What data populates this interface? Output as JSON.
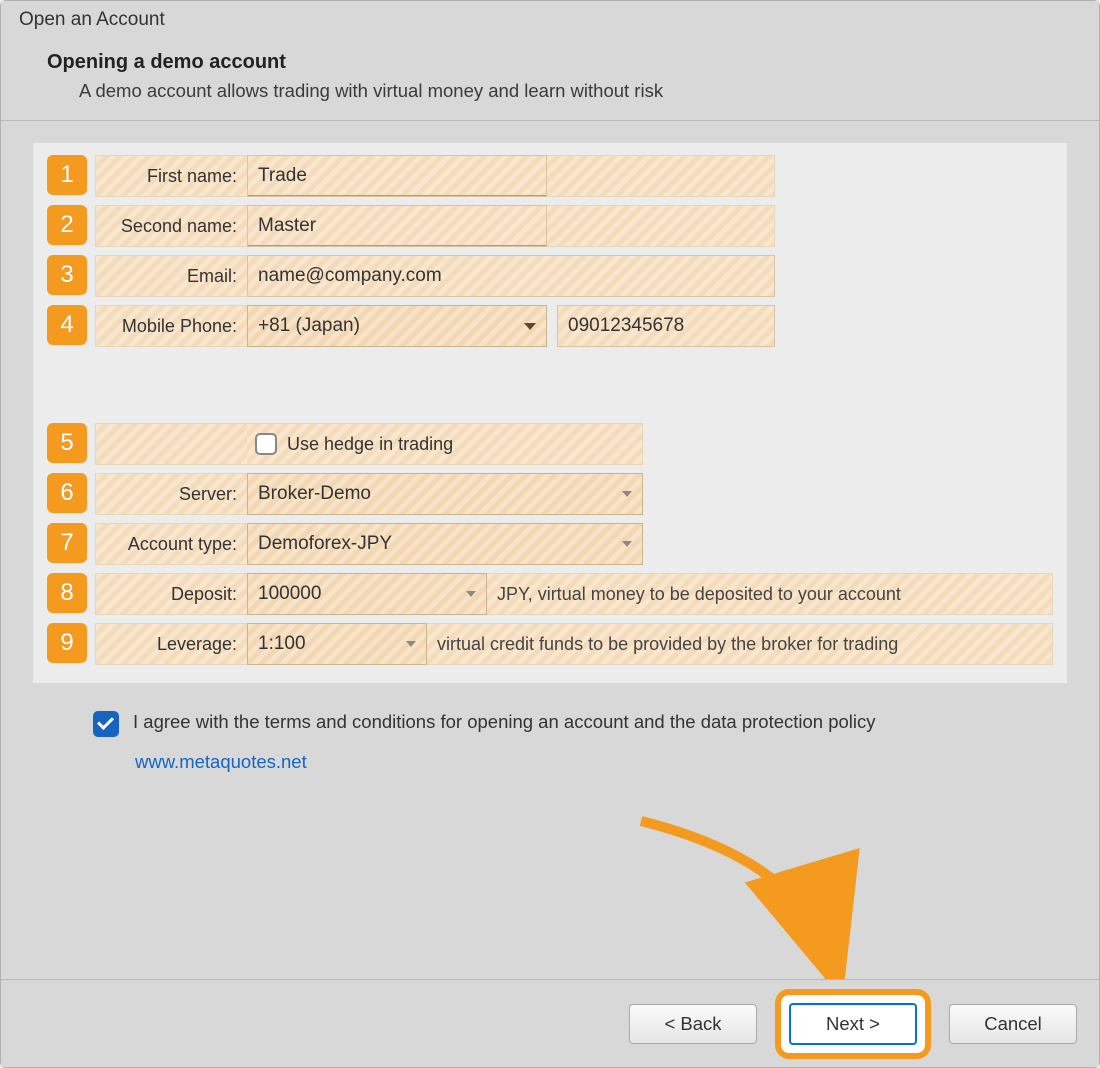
{
  "window": {
    "title": "Open an Account"
  },
  "heading": {
    "title": "Opening a demo account",
    "subtitle": "A demo account allows trading with virtual money and learn without risk"
  },
  "badges": [
    "1",
    "2",
    "3",
    "4",
    "5",
    "6",
    "7",
    "8",
    "9"
  ],
  "fields": {
    "first_name": {
      "label": "First name:",
      "value": "Trade"
    },
    "second_name": {
      "label": "Second name:",
      "value": "Master"
    },
    "email": {
      "label": "Email:",
      "value": "name@company.com"
    },
    "phone": {
      "label": "Mobile Phone:",
      "country": "+81 (Japan)",
      "number": "09012345678"
    },
    "hedge": {
      "label": "Use hedge in trading",
      "checked": false
    },
    "server": {
      "label": "Server:",
      "value": "Broker-Demo"
    },
    "account_type": {
      "label": "Account type:",
      "value": "Demoforex-JPY"
    },
    "deposit": {
      "label": "Deposit:",
      "value": "100000",
      "trail": "JPY, virtual money to be deposited to your account"
    },
    "leverage": {
      "label": "Leverage:",
      "value": "1:100",
      "trail": "virtual credit funds to be provided by the broker for trading"
    }
  },
  "agreement": {
    "text": "I agree with the terms and conditions for opening an account and the data protection policy",
    "link": "www.metaquotes.net",
    "checked": true
  },
  "buttons": {
    "back": "< Back",
    "next": "Next >",
    "cancel": "Cancel"
  }
}
